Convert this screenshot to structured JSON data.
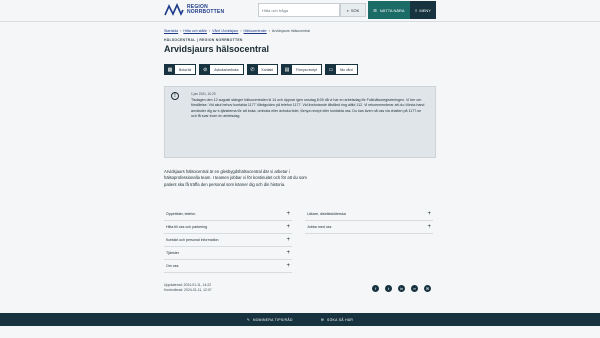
{
  "header": {
    "logo_line1": "REGION",
    "logo_line2": "NORRBOTTEN",
    "search_placeholder": "Hitta och fråga",
    "search_label": "SÖK",
    "nearby_label": "NÄTTA NÄRA",
    "menu_label": "MENY"
  },
  "breadcrumb": [
    "Startsida",
    "Hitta och ställe",
    "Vård i Arvidsjaur",
    "Hälsocentraler",
    "Arvidsjaurs hälsocentral"
  ],
  "overline": "HÄLSOCENTRAL | REGION NORRBOTTEN",
  "title": "Arvidsjaurs hälsocentral",
  "actions": [
    {
      "label": "Boka tid",
      "icon": "calendar-icon"
    },
    {
      "label": "Avboka/omboka",
      "icon": "calendar-x-icon"
    },
    {
      "label": "Kontakt",
      "icon": "phone-icon"
    },
    {
      "label": "Förnya recept",
      "icon": "prescription-icon"
    },
    {
      "label": "Nio vård",
      "icon": "chat-icon"
    }
  ],
  "notice": {
    "date": "1 jan 2021, 10:20",
    "text": "Tisdagen den 12 augusti stänger hälsocentralen kl 14 och öppnar igen onsdag 8:00 då vi har en arbetsdag för Folkhälsoregistreringen. Vi ber om förståelse. Vid akut behov kontakta 1177 Vårdguiden på telefon 1177. Vid livshotande tillstånd ring alltid 112. Vi rekommenderar att du i första hand använder dig av e-tjänsterna för att boka, omboka eller avboka tider, förnya recept eller kontakta oss. Du kan även nå oss via chatten på 1177.se och få svar inom en arbetsdag."
  },
  "intro": "Arvidsjaurs hälsocentral är en glesbygdshälsocentral där vi arbetar i hälsoprofessionella team. I teamen jobbar vi för kontinuitet och för att du som patient ska få träffa den personal som känner dig och din historia.",
  "accordion_left": [
    "Öppettider, telefon",
    "Hitta till oss och parkering",
    "Kontakt och personal information",
    "Tjänster",
    "Om oss"
  ],
  "accordion_right": [
    "Läkare, distriktsköterska",
    "Jobba med oss"
  ],
  "updated": {
    "line1": "Uppdaterad: 2024-01-11, 14:22",
    "line2": "Kontrollerad: 2024-01-11, 12:07"
  },
  "share_icons": [
    "facebook-icon",
    "twitter-icon",
    "linkedin-icon",
    "link-icon",
    "mail-icon"
  ],
  "footer": {
    "link1": "NOMINERA TIPS/RÅD",
    "link2": "SÖKA SÅ HÄR"
  }
}
